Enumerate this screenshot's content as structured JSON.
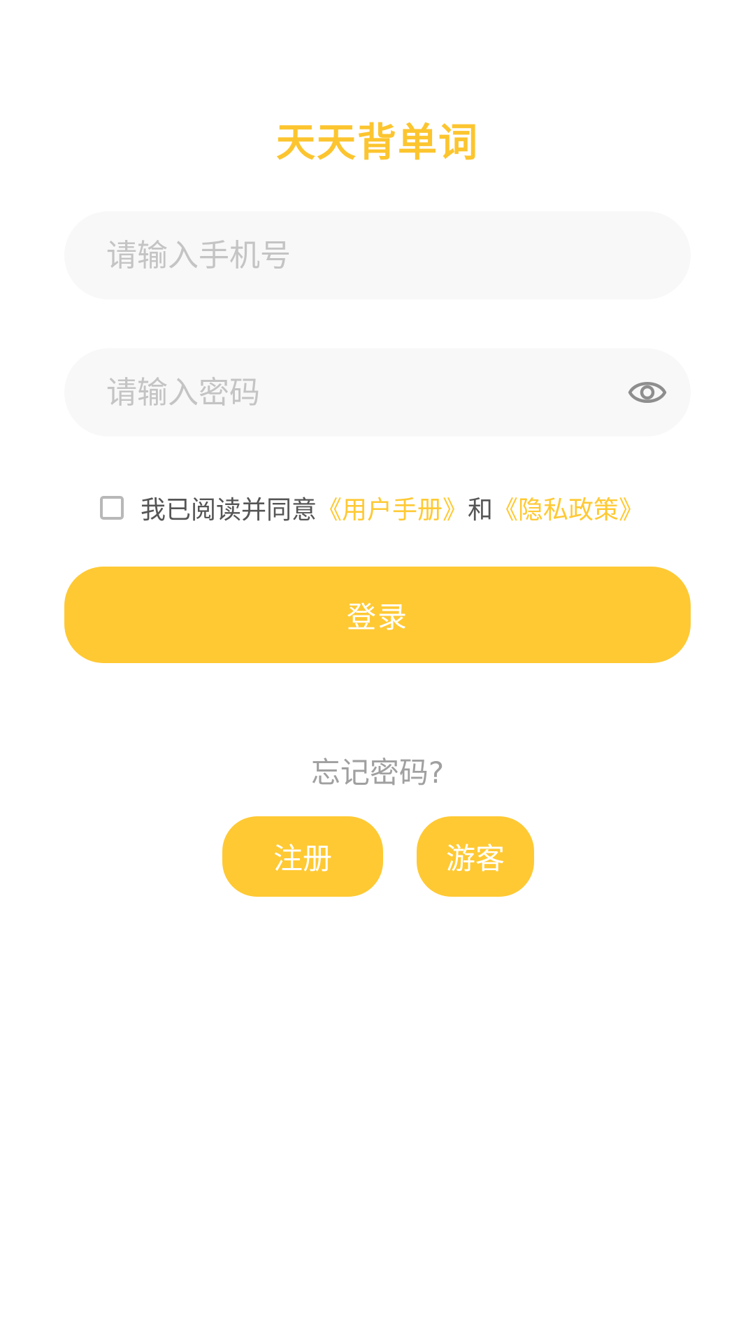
{
  "colors": {
    "accent": "#FFC933",
    "title": "#FCC52F",
    "placeholder": "#C4C4C4",
    "field_bg": "#F8F8F8",
    "muted_text": "#A0A0A0"
  },
  "app": {
    "title": "天天背单词"
  },
  "form": {
    "phone_placeholder": "请输入手机号",
    "phone_value": "",
    "password_placeholder": "请输入密码",
    "password_value": "",
    "password_toggle_icon": "eye-icon"
  },
  "agreement": {
    "checked": false,
    "prefix": "我已阅读并同意",
    "user_manual_link": "《用户手册》",
    "conjunction": "和",
    "privacy_link": "《隐私政策》"
  },
  "actions": {
    "login_label": "登录",
    "forgot_password_label": "忘记密码?",
    "register_label": "注册",
    "guest_label": "游客"
  }
}
